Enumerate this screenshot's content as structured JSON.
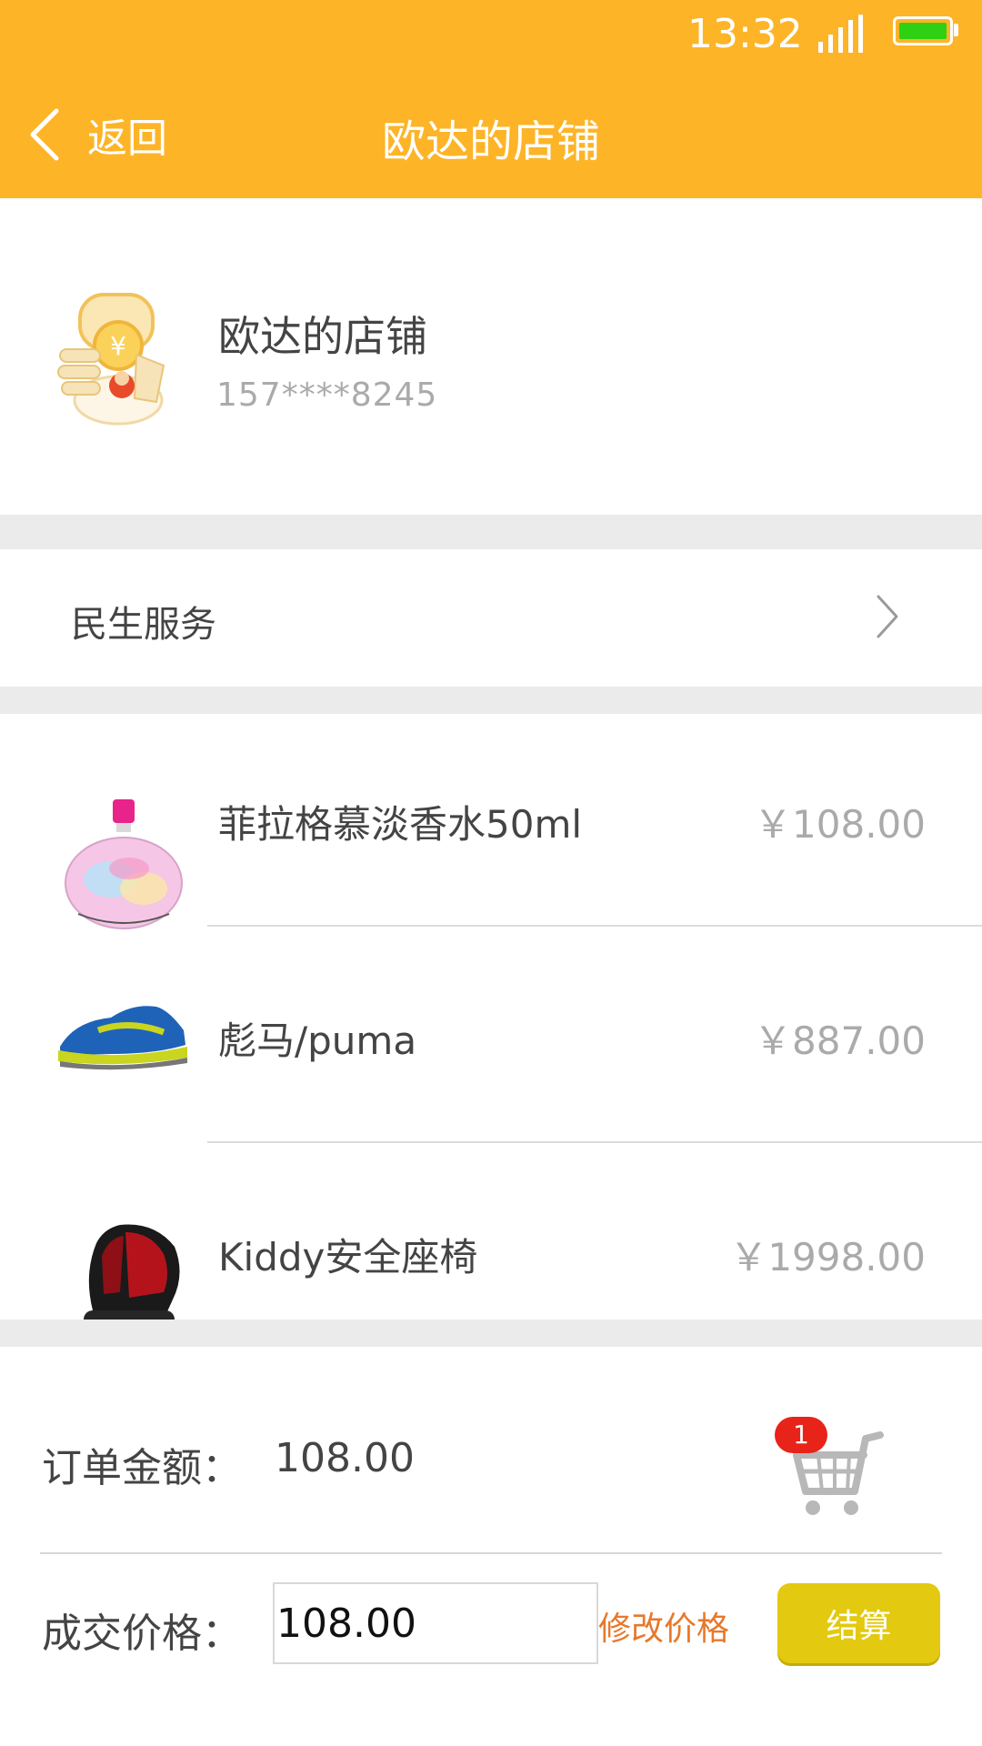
{
  "status_bar": {
    "time": "13:32"
  },
  "header": {
    "back_label": "返回",
    "title": "欧达的店铺"
  },
  "shop": {
    "name": "欧达的店铺",
    "phone": "157****8245"
  },
  "service": {
    "label": "民生服务"
  },
  "products": [
    {
      "name": "菲拉格慕淡香水50ml",
      "price": "￥108.00"
    },
    {
      "name": "彪马/puma",
      "price": "￥887.00"
    },
    {
      "name": "Kiddy安全座椅",
      "price": "￥1998.00"
    }
  ],
  "order": {
    "amount_label": "订单金额：",
    "amount_value": "108.00",
    "cart_count": "1",
    "deal_label": "成交价格：",
    "deal_price_value": "108.00",
    "modify_label": "修改价格",
    "checkout_label": "结算"
  },
  "colors": {
    "header_bg": "#fdb427",
    "checkout_bg": "#e3c90f",
    "modify_link": "#e8782a",
    "badge": "#e8231a",
    "battery": "#2ed013"
  }
}
